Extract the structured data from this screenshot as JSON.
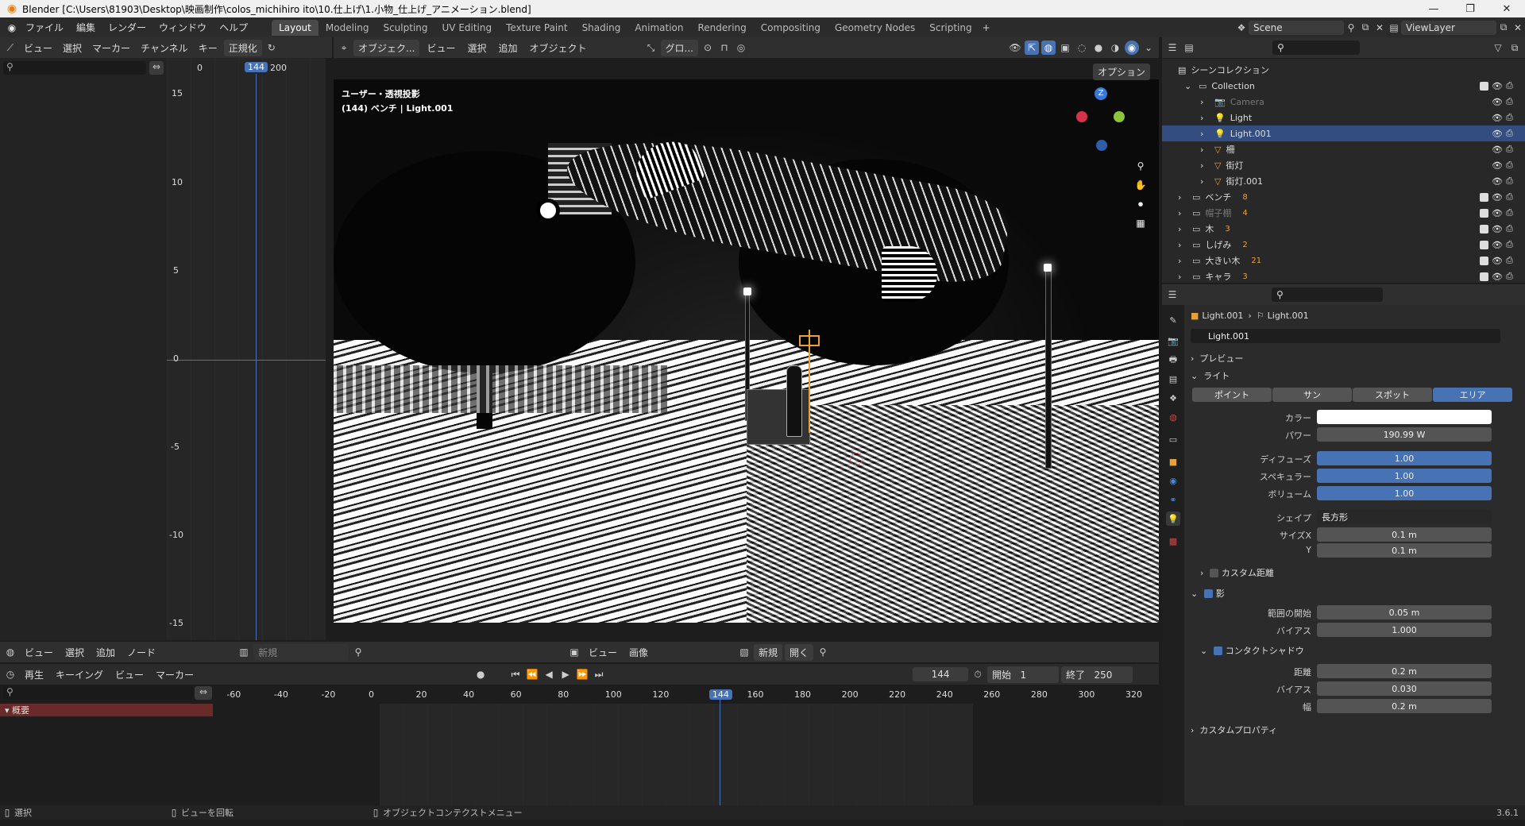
{
  "window": {
    "title": "Blender [C:\\Users\\81903\\Desktop\\映画制作\\colos_michihiro ito\\10.仕上げ\\1.小物_仕上げ_アニメーション.blend]"
  },
  "menu": [
    "ファイル",
    "編集",
    "レンダー",
    "ウィンドウ",
    "ヘルプ"
  ],
  "workspaces": [
    "Layout",
    "Modeling",
    "Sculpting",
    "UV Editing",
    "Texture Paint",
    "Shading",
    "Animation",
    "Rendering",
    "Compositing",
    "Geometry Nodes",
    "Scripting"
  ],
  "scene": {
    "scene_name": "Scene",
    "view_layer": "ViewLayer"
  },
  "graph_editor": {
    "menus": [
      "ビュー",
      "選択",
      "マーカー",
      "チャンネル",
      "キー"
    ],
    "normalize": "正規化",
    "frames": [
      "0",
      "144",
      "200"
    ],
    "y_ticks": [
      "15",
      "10",
      "5",
      "0",
      "-5",
      "-10",
      "-15"
    ]
  },
  "viewport": {
    "menus": [
      "オブジェク...",
      "ビュー",
      "選択",
      "追加",
      "オブジェクト"
    ],
    "transform": "グロ...",
    "info_line1": "ユーザー・透視投影",
    "info_line2": "(144) ベンチ | Light.001",
    "options": "オプション",
    "gizmo_z": "Z"
  },
  "outliner": {
    "root": "シーンコレクション",
    "items": [
      {
        "name": "Collection",
        "kind": "collection"
      },
      {
        "name": "Camera",
        "kind": "camera",
        "dim": true
      },
      {
        "name": "Light",
        "kind": "light"
      },
      {
        "name": "Light.001",
        "kind": "light",
        "selected": true
      },
      {
        "name": "柵",
        "kind": "mesh"
      },
      {
        "name": "街灯",
        "kind": "mesh"
      },
      {
        "name": "街灯.001",
        "kind": "mesh"
      },
      {
        "name": "ベンチ",
        "kind": "collection",
        "count": "8"
      },
      {
        "name": "帽子棚",
        "kind": "collection",
        "count": "4",
        "dim": true
      },
      {
        "name": "木",
        "kind": "collection",
        "count": "3"
      },
      {
        "name": "しげみ",
        "kind": "collection",
        "count": "2"
      },
      {
        "name": "大きい木",
        "kind": "collection",
        "count": "21"
      },
      {
        "name": "キャラ",
        "kind": "collection",
        "count": "3"
      }
    ]
  },
  "properties": {
    "breadcrumb_obj": "Light.001",
    "breadcrumb_data": "Light.001",
    "datablock": "Light.001",
    "section_preview": "プレビュー",
    "section_light": "ライト",
    "light_types": [
      "ポイント",
      "サン",
      "スポット",
      "エリア"
    ],
    "color_label": "カラー",
    "power_label": "パワー",
    "power": "190.99 W",
    "diffuse_label": "ディフューズ",
    "diffuse": "1.00",
    "specular_label": "スペキュラー",
    "specular": "1.00",
    "volume_label": "ボリューム",
    "volume": "1.00",
    "shape_label": "シェイプ",
    "shape": "長方形",
    "sizex_label": "サイズX",
    "sizex": "0.1 m",
    "y_label": "Y",
    "y": "0.1 m",
    "custom_distance": "カスタム距離",
    "shadow": "影",
    "clip_start_label": "範囲の開始",
    "clip_start": "0.05 m",
    "bias_label": "バイアス",
    "bias": "1.000",
    "contact_shadow": "コンタクトシャドウ",
    "distance_label": "距離",
    "distance": "0.2 m",
    "cbias_label": "バイアス",
    "cbias": "0.030",
    "width_label": "幅",
    "width": "0.2 m",
    "custom_props": "カスタムプロパティ"
  },
  "shader_bar": {
    "menus": [
      "ビュー",
      "選択",
      "追加",
      "ノード"
    ],
    "new": "新規"
  },
  "image_bar": {
    "menus": [
      "ビュー",
      "画像"
    ],
    "new": "新規",
    "open": "開く"
  },
  "timeline": {
    "playback": "再生",
    "keying": "キーイング",
    "view": "ビュー",
    "marker": "マーカー",
    "current": "144",
    "start_label": "開始",
    "start": "1",
    "end_label": "終了",
    "end": "250",
    "summary": "概要",
    "ticks": [
      "-60",
      "-40",
      "-20",
      "0",
      "20",
      "40",
      "60",
      "80",
      "100",
      "120",
      "144",
      "160",
      "180",
      "200",
      "220",
      "240",
      "260",
      "280",
      "300",
      "320"
    ]
  },
  "status": {
    "select": "選択",
    "rotate": "ビューを回転",
    "context": "オブジェクトコンテクストメニュー",
    "version": "3.6.1"
  }
}
